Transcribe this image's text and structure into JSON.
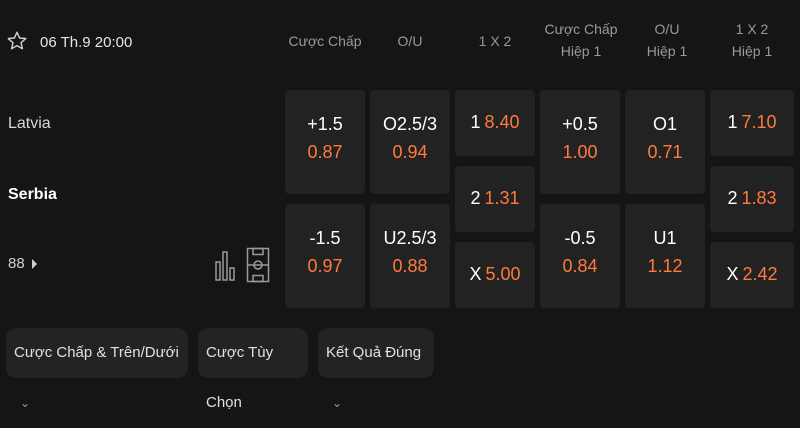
{
  "match": {
    "datetime": "06 Th.9 20:00",
    "team_home": "Latvia",
    "team_away": "Serbia",
    "more_count": "88"
  },
  "headers": {
    "handicap": "Cược Chấp",
    "ou": "O/U",
    "x12": "1 X 2",
    "handicap_h1_line1": "Cược Chấp",
    "handicap_h1_line2": "Hiệp 1",
    "ou_h1_line1": "O/U",
    "ou_h1_line2": "Hiệp 1",
    "x12_h1_line1": "1 X 2",
    "x12_h1_line2": "Hiệp 1"
  },
  "odds": {
    "handicap": {
      "home_line": "+1.5",
      "home_odds": "0.87",
      "away_line": "-1.5",
      "away_odds": "0.97"
    },
    "ou": {
      "over_line": "O2.5/3",
      "over_odds": "0.94",
      "under_line": "U2.5/3",
      "under_odds": "0.88"
    },
    "x12": {
      "home_label": "1",
      "home_odds": "8.40",
      "away_label": "2",
      "away_odds": "1.31",
      "draw_label": "X",
      "draw_odds": "5.00"
    },
    "handicap_h1": {
      "home_line": "+0.5",
      "home_odds": "1.00",
      "away_line": "-0.5",
      "away_odds": "0.84"
    },
    "ou_h1": {
      "over_line": "O1",
      "over_odds": "0.71",
      "under_line": "U1",
      "under_odds": "1.12"
    },
    "x12_h1": {
      "home_label": "1",
      "home_odds": "7.10",
      "away_label": "2",
      "away_odds": "1.83",
      "draw_label": "X",
      "draw_odds": "2.42"
    }
  },
  "tabs": [
    {
      "label": "Cược Chấp & Trên/Dưới"
    },
    {
      "label": "Cược Tùy Chọn"
    },
    {
      "label": "Kết Quả Đúng"
    }
  ],
  "icons": [
    "star-icon",
    "stats-icon",
    "field-icon",
    "chevron-right-icon",
    "chevron-down-icon"
  ],
  "colors": {
    "odds": "#ff7a3c",
    "background": "#151515",
    "cell": "#222222"
  }
}
